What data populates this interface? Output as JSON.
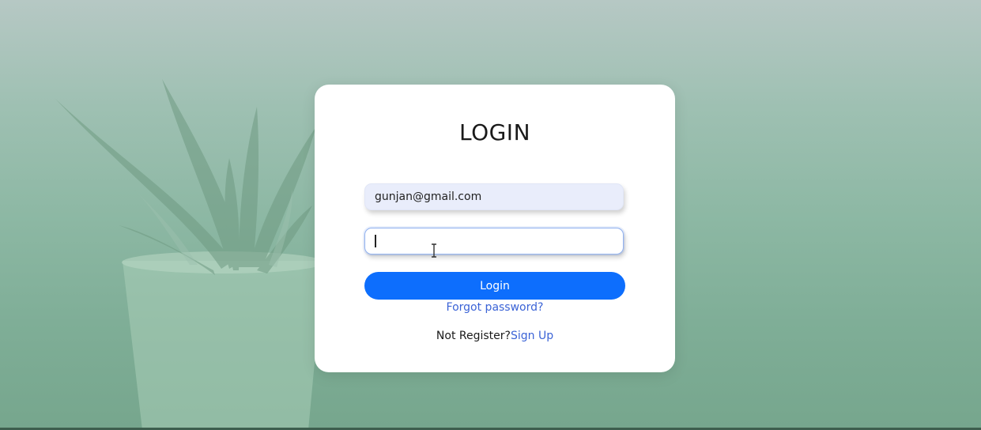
{
  "login_form": {
    "title": "LOGIN",
    "email_value": "gunjan@gmail.com",
    "password_value": "",
    "login_button_label": "Login",
    "forgot_password_label": "Forgot password?",
    "not_registered_text": "Not Register?",
    "sign_up_label": "Sign Up"
  },
  "colors": {
    "primary": "#0d6efd",
    "link": "#3b63d6",
    "card_background": "#ffffff",
    "email_field_background": "#e9edfb"
  },
  "icons": {
    "background": "aloe-plant-background",
    "text_cursor": "i-beam-cursor-icon"
  }
}
